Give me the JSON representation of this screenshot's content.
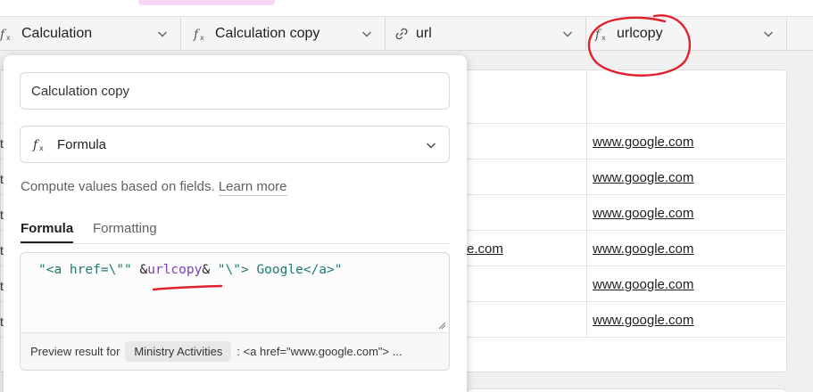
{
  "header": {
    "columns": [
      {
        "label": "Calculation",
        "icon": "formula-icon"
      },
      {
        "label": "Calculation copy",
        "icon": "formula-icon"
      },
      {
        "label": "url",
        "icon": "link-icon"
      },
      {
        "label": "urlcopy",
        "icon": "formula-icon"
      }
    ]
  },
  "grid": {
    "partial_cell": "e.com",
    "row_edge_char": "t",
    "links": [
      "www.google.com",
      "www.google.com",
      "www.google.com",
      "www.google.com",
      "www.google.com",
      "www.google.com"
    ]
  },
  "panel": {
    "name_value": "Calculation copy",
    "field_type": "Formula",
    "description": "Compute values based on fields.",
    "learn_more": "Learn more",
    "tabs": [
      "Formula",
      "Formatting"
    ],
    "formula": {
      "part1": "\"<a href=\\\"\" ",
      "amp_open": "&",
      "field_ref": "urlcopy",
      "amp_close": "&",
      "part2": " \"\\\"> Google</a>\""
    },
    "preview": {
      "label": "Preview result for",
      "record": "Ministry Activities",
      "value": ": <a href=\"www.google.com\"> ..."
    }
  },
  "colors": {
    "annotation": "#e0202a",
    "formula_text": "#1e7a73",
    "field_ref": "#7b3fb6"
  }
}
